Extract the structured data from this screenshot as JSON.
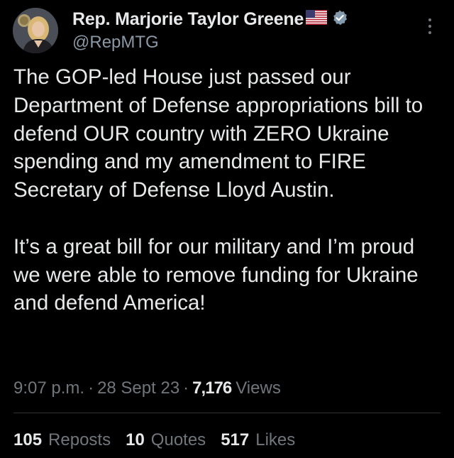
{
  "author": {
    "display_name": "Rep. Marjorie Taylor Greene",
    "handle": "@RepMTG",
    "flag_icon": "us-flag-icon",
    "verified_icon": "verified-badge-icon",
    "verified_color": "#829aab"
  },
  "tweet": {
    "paragraphs": [
      "The GOP-led House just passed our Department of Defense appropriations bill to defend OUR country with ZERO Ukraine spending and my amendment to FIRE Secretary of Defense Lloyd Austin.",
      "It’s a great bill for our military and I’m proud we were able to remove funding for Ukraine and defend America!"
    ]
  },
  "meta": {
    "time": "9:07 p.m.",
    "separator": "·",
    "date": "28 Sept 23",
    "views_count": "7,176",
    "views_label": "Views"
  },
  "stats": {
    "reposts_count": "105",
    "reposts_label": "Reposts",
    "quotes_count": "10",
    "quotes_label": "Quotes",
    "likes_count": "517",
    "likes_label": "Likes"
  },
  "colors": {
    "background": "#000000",
    "primary_text": "#e7e9ea",
    "secondary_text": "#71767b",
    "divider": "#2f3336"
  }
}
